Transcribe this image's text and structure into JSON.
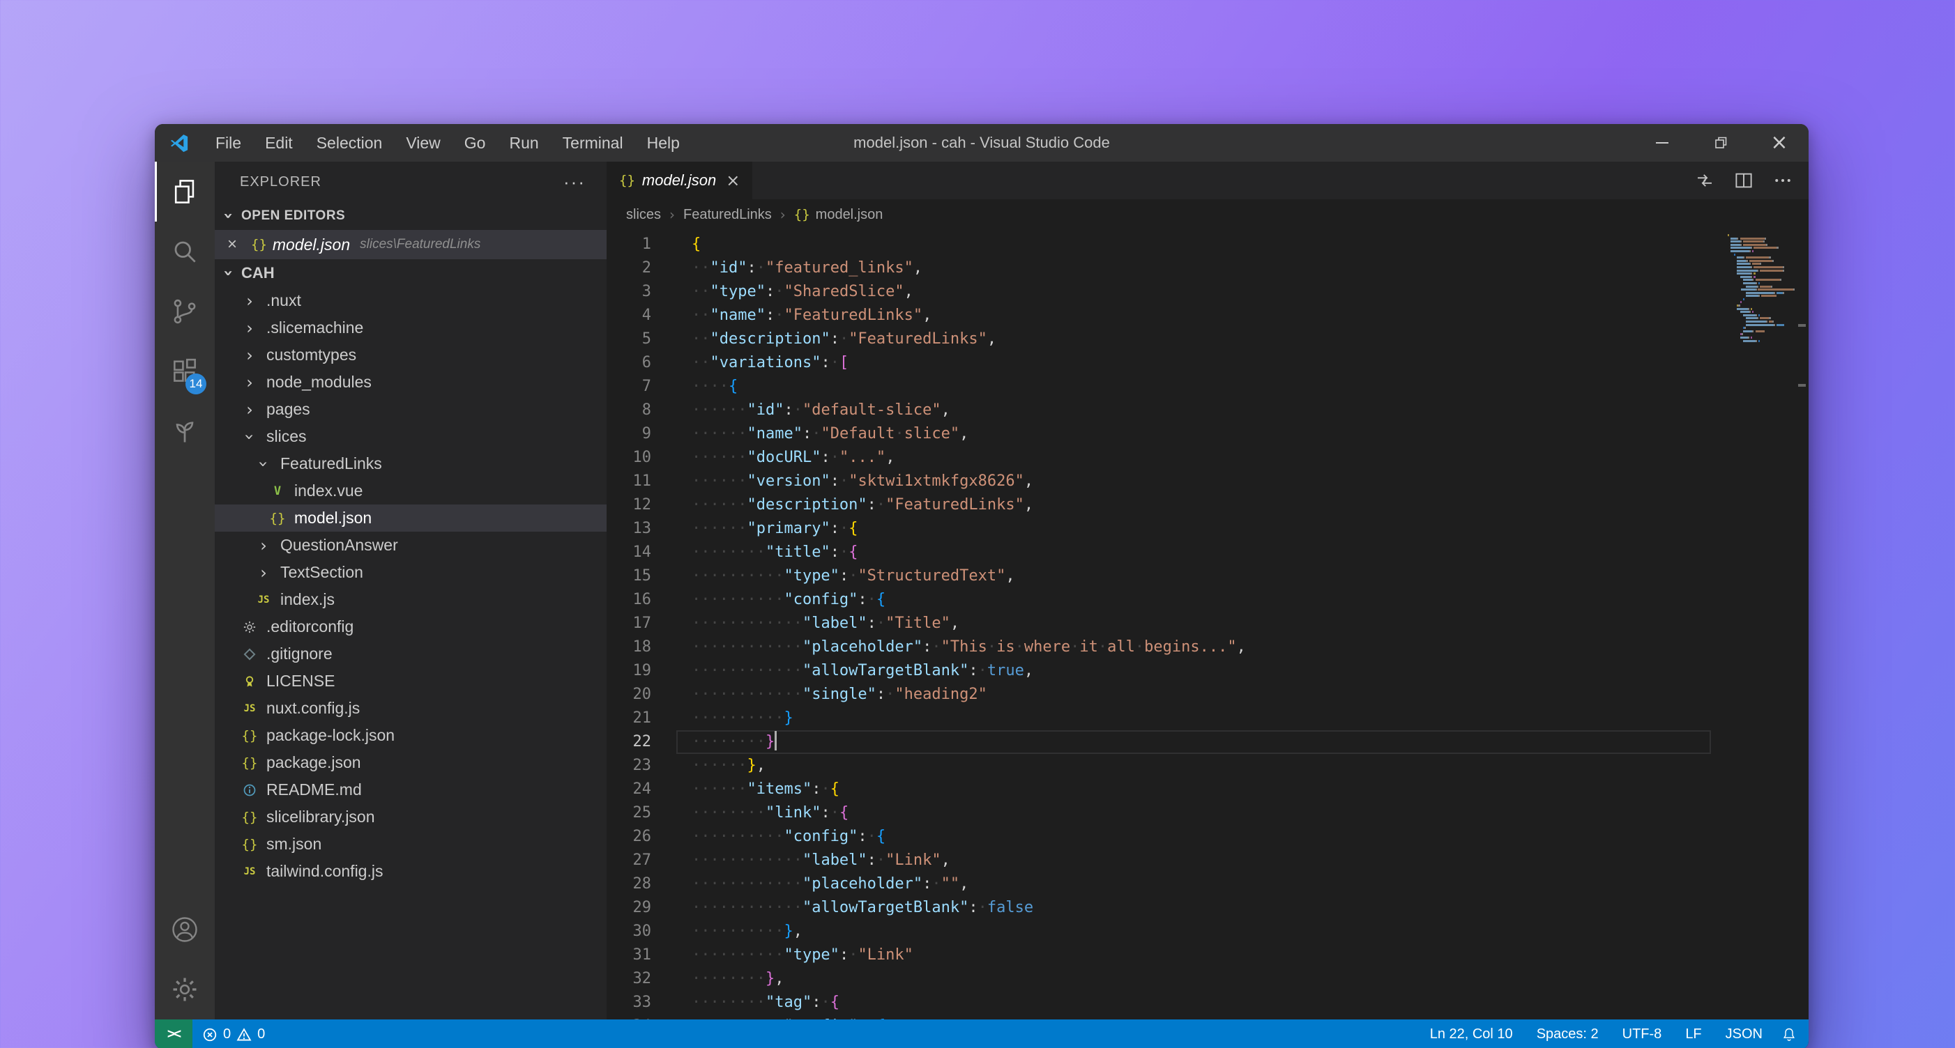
{
  "window": {
    "title": "model.json - cah - Visual Studio Code",
    "menus": [
      "File",
      "Edit",
      "Selection",
      "View",
      "Go",
      "Run",
      "Terminal",
      "Help"
    ]
  },
  "activity_bar": {
    "extensions_badge": "14"
  },
  "sidebar": {
    "title": "EXPLORER",
    "open_editors": {
      "label": "OPEN EDITORS",
      "items": [
        {
          "name": "model.json",
          "detail": "slices\\FeaturedLinks",
          "icon": "json",
          "active": true
        }
      ]
    },
    "root": "CAH",
    "tree": [
      {
        "label": ".nuxt",
        "level": 1,
        "chevron": "right"
      },
      {
        "label": ".slicemachine",
        "level": 1,
        "chevron": "right"
      },
      {
        "label": "customtypes",
        "level": 1,
        "chevron": "right"
      },
      {
        "label": "node_modules",
        "level": 1,
        "chevron": "right"
      },
      {
        "label": "pages",
        "level": 1,
        "chevron": "right"
      },
      {
        "label": "slices",
        "level": 1,
        "chevron": "down"
      },
      {
        "label": "FeaturedLinks",
        "level": 2,
        "chevron": "down"
      },
      {
        "label": "index.vue",
        "level": 3,
        "icon": "vue"
      },
      {
        "label": "model.json",
        "level": 3,
        "icon": "json",
        "selected": true
      },
      {
        "label": "QuestionAnswer",
        "level": 2,
        "chevron": "right"
      },
      {
        "label": "TextSection",
        "level": 2,
        "chevron": "right"
      },
      {
        "label": "index.js",
        "level": 2,
        "icon": "js"
      },
      {
        "label": ".editorconfig",
        "level": 1,
        "icon": "gear"
      },
      {
        "label": ".gitignore",
        "level": 1,
        "icon": "git"
      },
      {
        "label": "LICENSE",
        "level": 1,
        "icon": "license"
      },
      {
        "label": "nuxt.config.js",
        "level": 1,
        "icon": "js"
      },
      {
        "label": "package-lock.json",
        "level": 1,
        "icon": "json"
      },
      {
        "label": "package.json",
        "level": 1,
        "icon": "json"
      },
      {
        "label": "README.md",
        "level": 1,
        "icon": "info"
      },
      {
        "label": "slicelibrary.json",
        "level": 1,
        "icon": "json"
      },
      {
        "label": "sm.json",
        "level": 1,
        "icon": "json"
      },
      {
        "label": "tailwind.config.js",
        "level": 1,
        "icon": "js"
      }
    ]
  },
  "editor": {
    "tabs": [
      {
        "label": "model.json",
        "icon": "json",
        "active": true
      }
    ],
    "breadcrumbs": [
      {
        "label": "slices"
      },
      {
        "label": "FeaturedLinks"
      },
      {
        "label": "model.json",
        "icon": "json"
      }
    ],
    "cursor": {
      "line": 22
    },
    "lines": [
      [
        [
          "g",
          "{"
        ]
      ],
      [
        [
          "w",
          2
        ],
        [
          "k",
          "\"id\""
        ],
        [
          "p",
          ":"
        ],
        [
          "w",
          1
        ],
        [
          "s",
          "\"featured_links\""
        ],
        [
          "p",
          ","
        ]
      ],
      [
        [
          "w",
          2
        ],
        [
          "k",
          "\"type\""
        ],
        [
          "p",
          ":"
        ],
        [
          "w",
          1
        ],
        [
          "s",
          "\"SharedSlice\""
        ],
        [
          "p",
          ","
        ]
      ],
      [
        [
          "w",
          2
        ],
        [
          "k",
          "\"name\""
        ],
        [
          "p",
          ":"
        ],
        [
          "w",
          1
        ],
        [
          "s",
          "\"FeaturedLinks\""
        ],
        [
          "p",
          ","
        ]
      ],
      [
        [
          "w",
          2
        ],
        [
          "k",
          "\"description\""
        ],
        [
          "p",
          ":"
        ],
        [
          "w",
          1
        ],
        [
          "s",
          "\"FeaturedLinks\""
        ],
        [
          "p",
          ","
        ]
      ],
      [
        [
          "w",
          2
        ],
        [
          "k",
          "\"variations\""
        ],
        [
          "p",
          ":"
        ],
        [
          "w",
          1
        ],
        [
          "o",
          "["
        ]
      ],
      [
        [
          "w",
          4
        ],
        [
          "u",
          "{"
        ]
      ],
      [
        [
          "w",
          6
        ],
        [
          "k",
          "\"id\""
        ],
        [
          "p",
          ":"
        ],
        [
          "w",
          1
        ],
        [
          "s",
          "\"default-slice\""
        ],
        [
          "p",
          ","
        ]
      ],
      [
        [
          "w",
          6
        ],
        [
          "k",
          "\"name\""
        ],
        [
          "p",
          ":"
        ],
        [
          "w",
          1
        ],
        [
          "s",
          "\"Default slice\""
        ],
        [
          "p",
          ","
        ]
      ],
      [
        [
          "w",
          6
        ],
        [
          "k",
          "\"docURL\""
        ],
        [
          "p",
          ":"
        ],
        [
          "w",
          1
        ],
        [
          "s",
          "\"...\""
        ],
        [
          "p",
          ","
        ]
      ],
      [
        [
          "w",
          6
        ],
        [
          "k",
          "\"version\""
        ],
        [
          "p",
          ":"
        ],
        [
          "w",
          1
        ],
        [
          "s",
          "\"sktwi1xtmkfgx8626\""
        ],
        [
          "p",
          ","
        ]
      ],
      [
        [
          "w",
          6
        ],
        [
          "k",
          "\"description\""
        ],
        [
          "p",
          ":"
        ],
        [
          "w",
          1
        ],
        [
          "s",
          "\"FeaturedLinks\""
        ],
        [
          "p",
          ","
        ]
      ],
      [
        [
          "w",
          6
        ],
        [
          "k",
          "\"primary\""
        ],
        [
          "p",
          ":"
        ],
        [
          "w",
          1
        ],
        [
          "g",
          "{"
        ]
      ],
      [
        [
          "w",
          8
        ],
        [
          "k",
          "\"title\""
        ],
        [
          "p",
          ":"
        ],
        [
          "w",
          1
        ],
        [
          "o",
          "{"
        ]
      ],
      [
        [
          "w",
          10
        ],
        [
          "k",
          "\"type\""
        ],
        [
          "p",
          ":"
        ],
        [
          "w",
          1
        ],
        [
          "s",
          "\"StructuredText\""
        ],
        [
          "p",
          ","
        ]
      ],
      [
        [
          "w",
          10
        ],
        [
          "k",
          "\"config\""
        ],
        [
          "p",
          ":"
        ],
        [
          "w",
          1
        ],
        [
          "u",
          "{"
        ]
      ],
      [
        [
          "w",
          12
        ],
        [
          "k",
          "\"label\""
        ],
        [
          "p",
          ":"
        ],
        [
          "w",
          1
        ],
        [
          "s",
          "\"Title\""
        ],
        [
          "p",
          ","
        ]
      ],
      [
        [
          "w",
          12
        ],
        [
          "k",
          "\"placeholder\""
        ],
        [
          "p",
          ":"
        ],
        [
          "w",
          1
        ],
        [
          "s",
          "\"This is where it all begins...\""
        ],
        [
          "p",
          ","
        ]
      ],
      [
        [
          "w",
          12
        ],
        [
          "k",
          "\"allowTargetBlank\""
        ],
        [
          "p",
          ":"
        ],
        [
          "w",
          1
        ],
        [
          "bl",
          "true"
        ],
        [
          "p",
          ","
        ]
      ],
      [
        [
          "w",
          12
        ],
        [
          "k",
          "\"single\""
        ],
        [
          "p",
          ":"
        ],
        [
          "w",
          1
        ],
        [
          "s",
          "\"heading2\""
        ]
      ],
      [
        [
          "w",
          10
        ],
        [
          "u",
          "}"
        ]
      ],
      [
        [
          "w",
          8
        ],
        [
          "o",
          "}"
        ],
        [
          "cursor",
          ""
        ]
      ],
      [
        [
          "w",
          6
        ],
        [
          "g",
          "}"
        ],
        [
          "p",
          ","
        ]
      ],
      [
        [
          "w",
          6
        ],
        [
          "k",
          "\"items\""
        ],
        [
          "p",
          ":"
        ],
        [
          "w",
          1
        ],
        [
          "g",
          "{"
        ]
      ],
      [
        [
          "w",
          8
        ],
        [
          "k",
          "\"link\""
        ],
        [
          "p",
          ":"
        ],
        [
          "w",
          1
        ],
        [
          "o",
          "{"
        ]
      ],
      [
        [
          "w",
          10
        ],
        [
          "k",
          "\"config\""
        ],
        [
          "p",
          ":"
        ],
        [
          "w",
          1
        ],
        [
          "u",
          "{"
        ]
      ],
      [
        [
          "w",
          12
        ],
        [
          "k",
          "\"label\""
        ],
        [
          "p",
          ":"
        ],
        [
          "w",
          1
        ],
        [
          "s",
          "\"Link\""
        ],
        [
          "p",
          ","
        ]
      ],
      [
        [
          "w",
          12
        ],
        [
          "k",
          "\"placeholder\""
        ],
        [
          "p",
          ":"
        ],
        [
          "w",
          1
        ],
        [
          "s",
          "\"\""
        ],
        [
          "p",
          ","
        ]
      ],
      [
        [
          "w",
          12
        ],
        [
          "k",
          "\"allowTargetBlank\""
        ],
        [
          "p",
          ":"
        ],
        [
          "w",
          1
        ],
        [
          "bl",
          "false"
        ]
      ],
      [
        [
          "w",
          10
        ],
        [
          "u",
          "}"
        ],
        [
          "p",
          ","
        ]
      ],
      [
        [
          "w",
          10
        ],
        [
          "k",
          "\"type\""
        ],
        [
          "p",
          ":"
        ],
        [
          "w",
          1
        ],
        [
          "s",
          "\"Link\""
        ]
      ],
      [
        [
          "w",
          8
        ],
        [
          "o",
          "}"
        ],
        [
          "p",
          ","
        ]
      ],
      [
        [
          "w",
          8
        ],
        [
          "k",
          "\"tag\""
        ],
        [
          "p",
          ":"
        ],
        [
          "w",
          1
        ],
        [
          "o",
          "{"
        ]
      ],
      [
        [
          "w",
          10
        ],
        [
          "k",
          "\"config\""
        ],
        [
          "p",
          ":"
        ],
        [
          "w",
          1
        ],
        [
          "u",
          "{"
        ]
      ]
    ]
  },
  "status_bar": {
    "errors": "0",
    "warnings": "0",
    "remote_icon": "><",
    "right": [
      "Ln 22, Col 10",
      "Spaces: 2",
      "UTF-8",
      "LF",
      "JSON"
    ]
  }
}
